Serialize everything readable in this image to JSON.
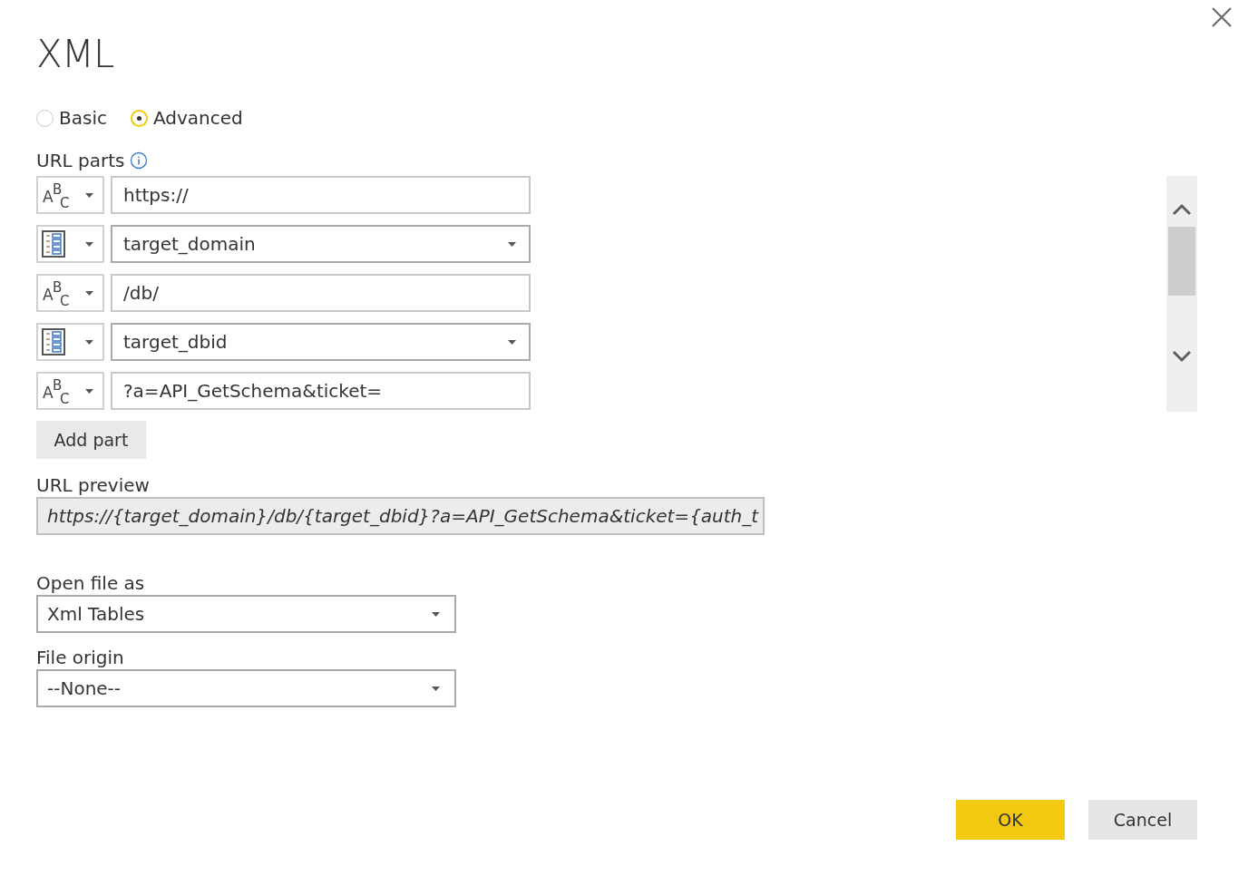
{
  "title": "XML",
  "mode_options": [
    {
      "label": "Basic",
      "selected": false
    },
    {
      "label": "Advanced",
      "selected": true
    }
  ],
  "url_parts": {
    "label": "URL parts",
    "parts": [
      {
        "kind": "text",
        "type_letters": [
          "A",
          "B",
          "C"
        ],
        "value": "https://"
      },
      {
        "kind": "parameter",
        "value": "target_domain"
      },
      {
        "kind": "text",
        "type_letters": [
          "A",
          "B",
          "C"
        ],
        "value": "/db/"
      },
      {
        "kind": "parameter",
        "value": "target_dbid"
      },
      {
        "kind": "text",
        "type_letters": [
          "A",
          "B",
          "C"
        ],
        "value": "?a=API_GetSchema&ticket="
      }
    ],
    "add_button": "Add part"
  },
  "url_preview": {
    "label": "URL preview",
    "value": "https://{target_domain}/db/{target_dbid}?a=API_GetSchema&ticket={auth_t"
  },
  "open_file_as": {
    "label": "Open file as",
    "value": "Xml Tables"
  },
  "file_origin": {
    "label": "File origin",
    "value": "--None--"
  },
  "buttons": [
    {
      "label": "OK",
      "kind": "primary"
    },
    {
      "label": "Cancel",
      "kind": "secondary"
    }
  ]
}
